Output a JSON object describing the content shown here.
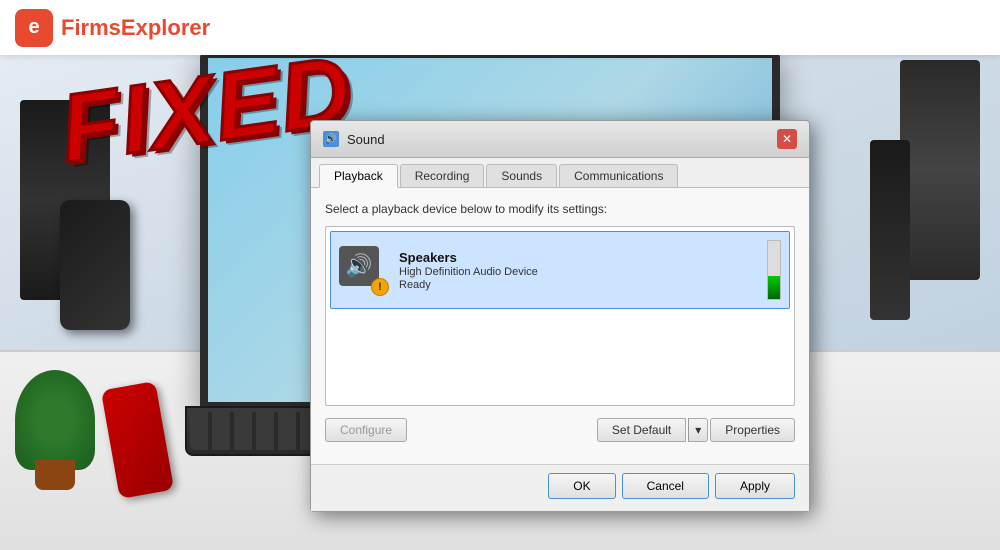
{
  "logo": {
    "icon_letter": "e",
    "brand_first": "Firms",
    "brand_second": "Explorer"
  },
  "fixed_label": "FIXED",
  "dialog": {
    "title": "Sound",
    "close_icon": "✕",
    "tabs": [
      {
        "label": "Playback",
        "active": true
      },
      {
        "label": "Recording",
        "active": false
      },
      {
        "label": "Sounds",
        "active": false
      },
      {
        "label": "Communications",
        "active": false
      }
    ],
    "instruction": "Select a playback device below to modify its settings:",
    "device": {
      "name": "Speakers",
      "type": "High Definition Audio Device",
      "status": "Ready",
      "warning": "!"
    },
    "buttons": {
      "configure": "Configure",
      "set_default": "Set Default",
      "set_default_arrow": "▾",
      "properties": "Properties",
      "ok": "OK",
      "cancel": "Cancel",
      "apply": "Apply"
    }
  }
}
